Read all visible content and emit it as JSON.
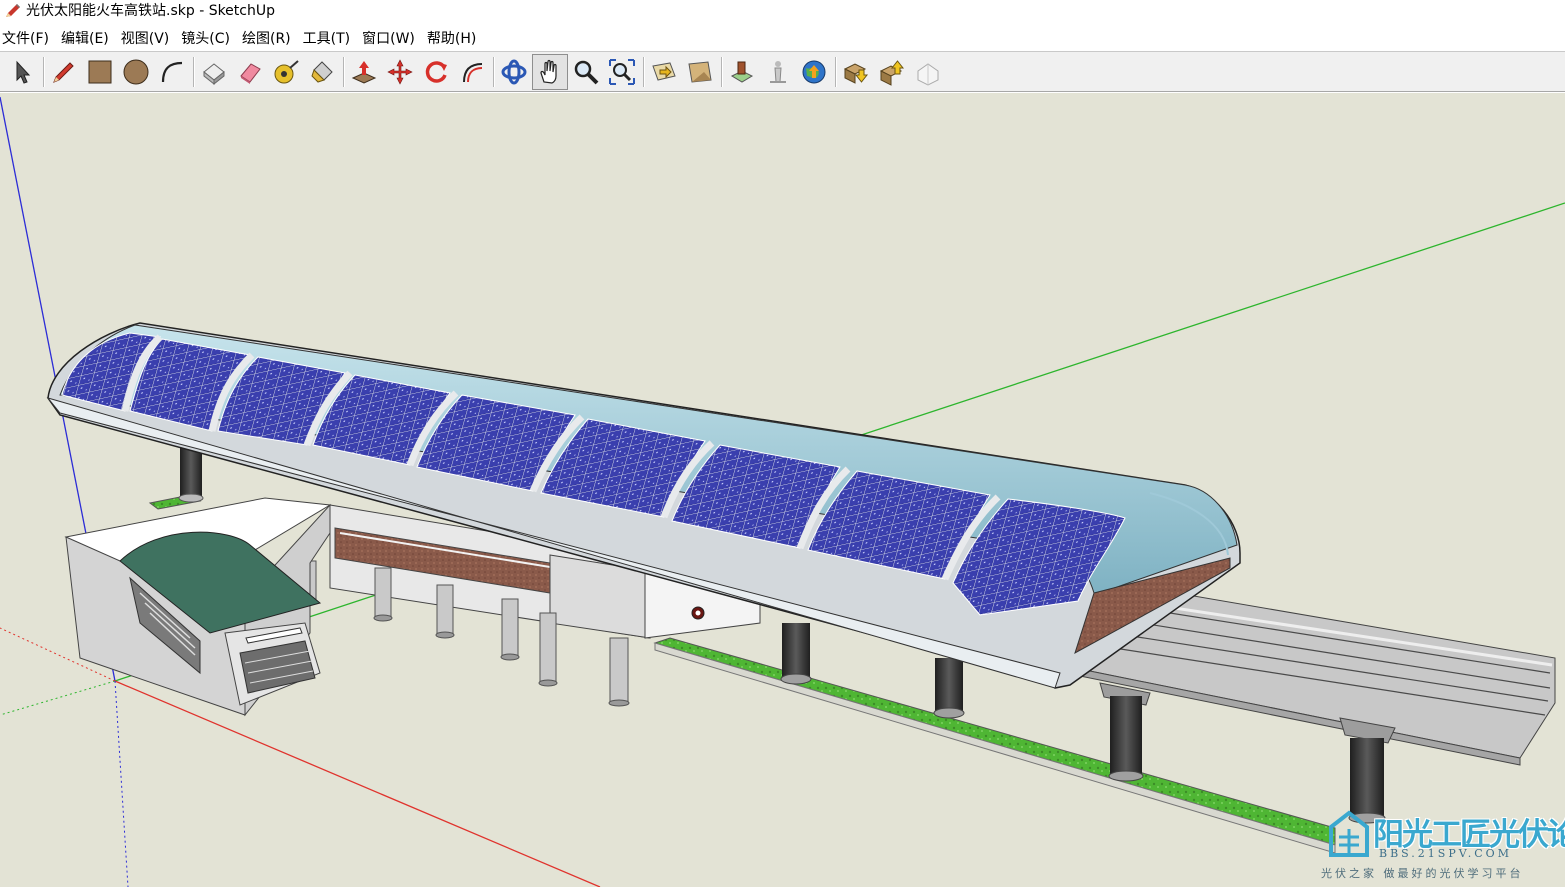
{
  "window": {
    "title": "光伏太阳能火车高铁站.skp - SketchUp",
    "app_icon": "sketchup-pencil-icon"
  },
  "menu": [
    "文件(F)",
    "编辑(E)",
    "视图(V)",
    "镜头(C)",
    "绘图(R)",
    "工具(T)",
    "窗口(W)",
    "帮助(H)"
  ],
  "toolbar": {
    "active_tool": "pan-tool",
    "groups": [
      [
        "select-tool"
      ],
      [
        "pencil-line-tool",
        "rectangle-tool",
        "circle-tool",
        "arc-tool"
      ],
      [
        "make-component-tool",
        "eraser-tool",
        "tape-measure-tool",
        "paint-bucket-tool"
      ],
      [
        "push-pull-tool",
        "move-tool",
        "rotate-tool",
        "offset-tool"
      ],
      [
        "orbit-tool",
        "pan-tool",
        "zoom-tool",
        "zoom-extents-tool"
      ],
      [
        "previous-view-tool",
        "next-view-tool"
      ],
      [
        "get-models-tool",
        "position-camera-tool",
        "google-earth-tool"
      ],
      [
        "get-components-tool",
        "share-model-tool",
        "place-model-tool"
      ]
    ]
  },
  "viewport": {
    "background": "#e3e3d5",
    "axis_colors": {
      "x": "#e0332d",
      "y": "#2db52d",
      "z": "#2c2cd6"
    },
    "panel_color": "#2c2f8f",
    "grass_color": "#4fb634"
  },
  "watermark": {
    "title": "阳光工匠光伏论坛",
    "url": "BBS.21SPV.COM",
    "slogan": "光伏之家 做最好的光伏学习平台"
  }
}
